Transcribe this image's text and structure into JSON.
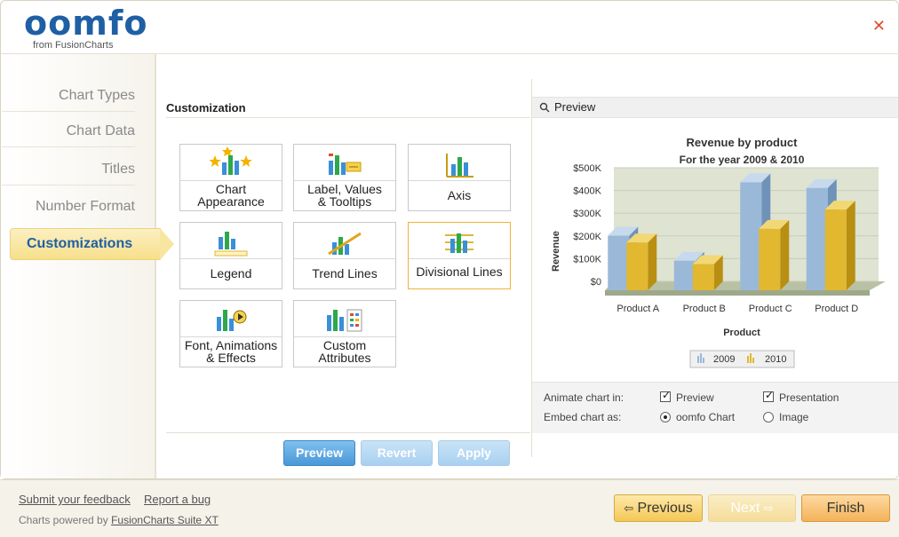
{
  "logo": {
    "letters": [
      "o",
      "o",
      "m",
      "f",
      "o"
    ],
    "subtitle": "from FusionCharts"
  },
  "window": {
    "close_symbol": "✕"
  },
  "sidebar": {
    "items": [
      {
        "label": "Chart Types"
      },
      {
        "label": "Chart Data"
      },
      {
        "label": "Titles"
      },
      {
        "label": "Number Format"
      },
      {
        "label": "Customizations",
        "active": true
      }
    ]
  },
  "customization": {
    "title": "Customization",
    "tiles": [
      {
        "label": "Chart Appearance",
        "lines": [
          "Chart",
          "Appearance"
        ],
        "icon": "chart-appearance-icon"
      },
      {
        "label": "Label, Values & Tooltips",
        "lines": [
          "Label, Values",
          "& Tooltips"
        ],
        "icon": "label-values-icon"
      },
      {
        "label": "Axis",
        "lines": [
          "Axis"
        ],
        "icon": "axis-icon"
      },
      {
        "label": "Legend",
        "lines": [
          "Legend"
        ],
        "icon": "legend-icon"
      },
      {
        "label": "Trend Lines",
        "lines": [
          "Trend Lines"
        ],
        "icon": "trend-lines-icon"
      },
      {
        "label": "Divisional Lines",
        "lines": [
          "Divisional Lines"
        ],
        "icon": "divisional-lines-icon",
        "selected": true
      },
      {
        "label": "Font, Animations & Effects",
        "lines": [
          "Font, Animations",
          "& Effects"
        ],
        "icon": "font-animations-icon"
      },
      {
        "label": "Custom Attributes",
        "lines": [
          "Custom",
          "Attributes"
        ],
        "icon": "custom-attributes-icon"
      }
    ],
    "buttons": {
      "preview": "Preview",
      "revert": "Revert",
      "apply": "Apply"
    }
  },
  "preview": {
    "title": "Preview",
    "options": {
      "animate_label": "Animate chart in:",
      "animate_preview": "Preview",
      "animate_presentation": "Presentation",
      "embed_label": "Embed chart as:",
      "embed_oomfo": "oomfo Chart",
      "embed_image": "Image"
    }
  },
  "chart_data": {
    "type": "bar",
    "title": "Revenue by product",
    "subtitle": "For the year 2009 & 2010",
    "xlabel": "Product",
    "ylabel": "Revenue",
    "categories": [
      "Product A",
      "Product B",
      "Product C",
      "Product D"
    ],
    "yticks": [
      "$0",
      "$100K",
      "$200K",
      "$300K",
      "$400K",
      "$500K"
    ],
    "ylim": [
      0,
      500000
    ],
    "series": [
      {
        "name": "2009",
        "values": [
          240000,
          130000,
          475000,
          450000
        ],
        "color": "#9ab8d8"
      },
      {
        "name": "2010",
        "values": [
          210000,
          115000,
          270000,
          355000
        ],
        "color": "#e2b830"
      }
    ],
    "grid": true,
    "legend": "bottom"
  },
  "footer": {
    "feedback": "Submit your feedback",
    "bug": "Report a bug",
    "powered_prefix": "Charts powered by ",
    "powered_link": "FusionCharts Suite XT",
    "previous": "Previous",
    "next": "Next",
    "finish": "Finish"
  }
}
